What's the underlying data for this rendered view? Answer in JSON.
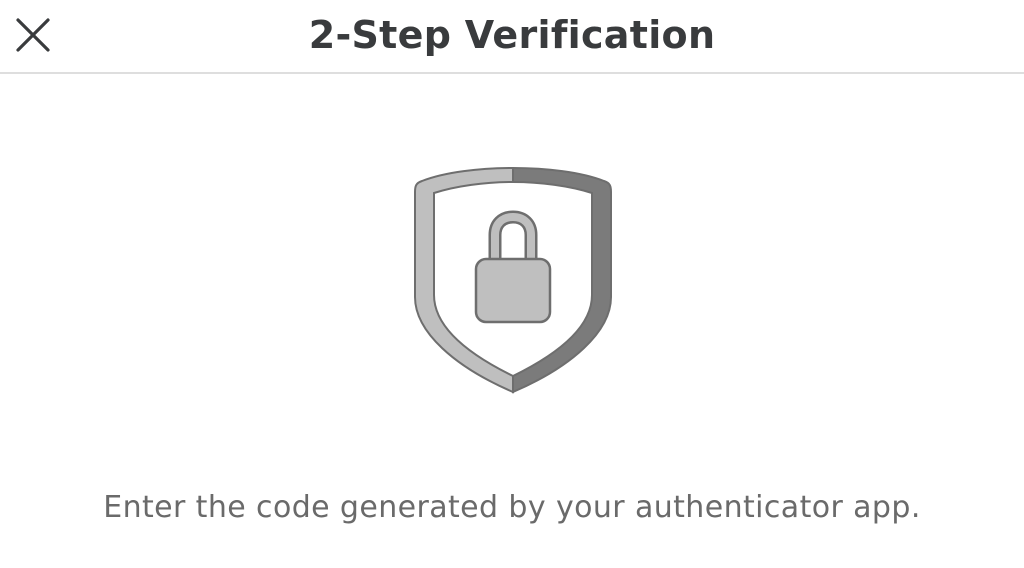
{
  "header": {
    "title": "2-Step Verification",
    "close_icon": "close-icon"
  },
  "illustration": {
    "icon": "shield-lock-icon",
    "colors": {
      "light_gray": "#bfbfbf",
      "dark_gray": "#7b7b7b",
      "outline": "#6e6e6e"
    }
  },
  "body": {
    "message": "Enter the code generated by your authenticator app."
  }
}
